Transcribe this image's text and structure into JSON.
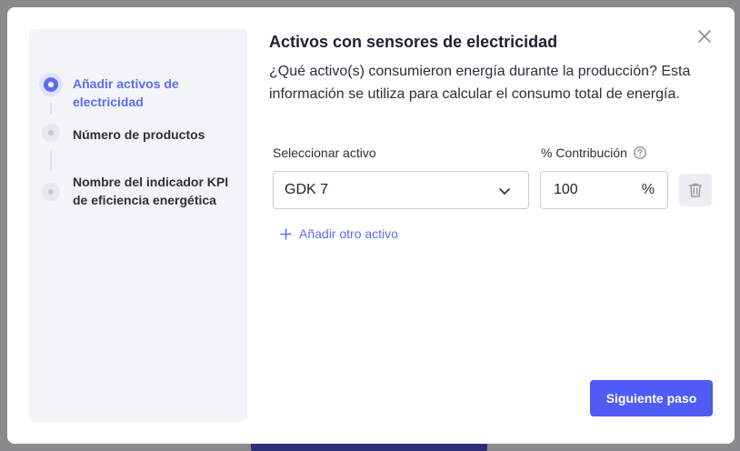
{
  "modal": {
    "title": "Activos con sensores de electricidad",
    "description": "¿Qué activo(s) consumieron energía durante la producción? Esta información se utiliza para calcular el consumo total de energía."
  },
  "steps": [
    {
      "label": "Añadir activos de electricidad",
      "state": "active"
    },
    {
      "label": "Número de productos",
      "state": "pending"
    },
    {
      "label": "Nombre del indicador KPI de eficiencia energética",
      "state": "pending"
    }
  ],
  "form": {
    "asset_label": "Seleccionar activo",
    "asset_value": "GDK 7",
    "contribution_label": "% Contribución",
    "contribution_value": "100",
    "contribution_unit": "%",
    "add_asset_label": "Añadir otro activo"
  },
  "footer": {
    "next_label": "Siguiente paso"
  },
  "colors": {
    "accent": "#5b6ef5",
    "primary_button": "#4f5bf4",
    "stepper_bg": "#f3f4f8",
    "overlay": "#8a8a8d"
  },
  "icons": {
    "close": "close-icon",
    "chevron": "chevron-down-icon",
    "help": "help-circle-icon",
    "trash": "trash-icon",
    "plus": "plus-icon"
  }
}
